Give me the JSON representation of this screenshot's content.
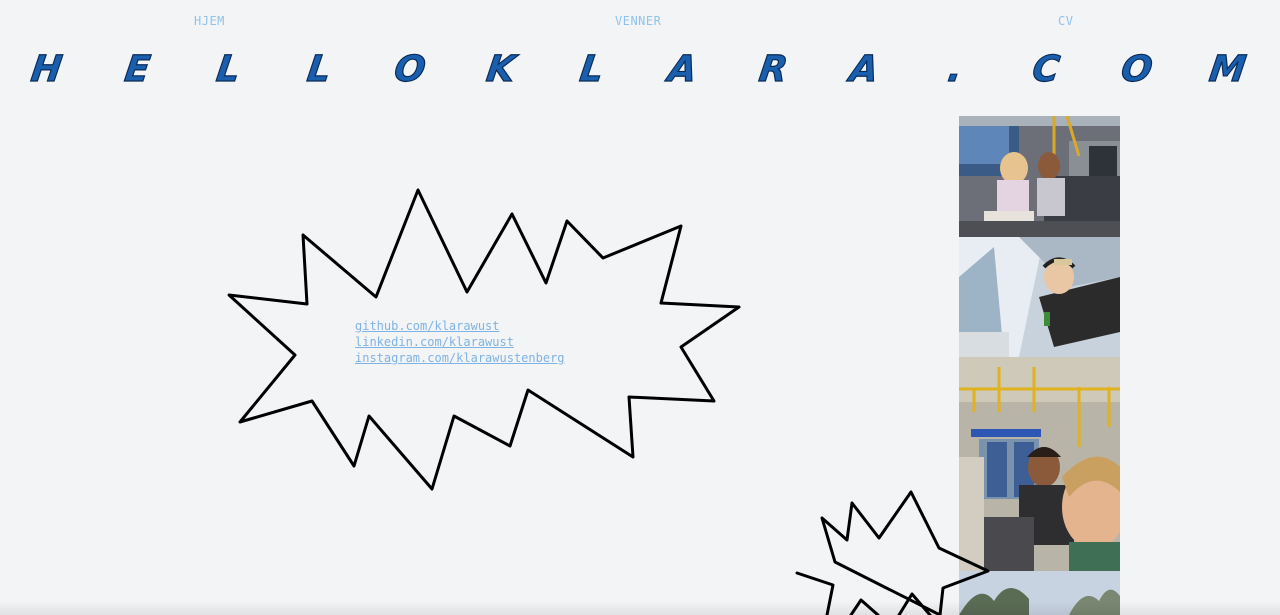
{
  "nav": {
    "home": "HJEM",
    "friends": "VENNER",
    "cv": "CV"
  },
  "title": {
    "letters": [
      "H",
      "E",
      "L",
      "L",
      "O",
      "K",
      "L",
      "A",
      "R",
      "A",
      ".",
      "C",
      "O",
      "M"
    ],
    "color": "#1a5fae"
  },
  "links": {
    "github": "github.com/klarawust",
    "linkedin": "linkedin.com/klarawust",
    "instagram": "instagram.com/klarawustenberg"
  },
  "photos": [
    {
      "name": "train-friends-photo"
    },
    {
      "name": "tilted-selfie-photo"
    },
    {
      "name": "metro-selfie-photo"
    },
    {
      "name": "sky-trees-photo"
    }
  ],
  "colors": {
    "background": "#f3f4f6",
    "nav": "#8ec3ee",
    "link": "#7fb3e3",
    "burst_stroke": "#000000"
  }
}
